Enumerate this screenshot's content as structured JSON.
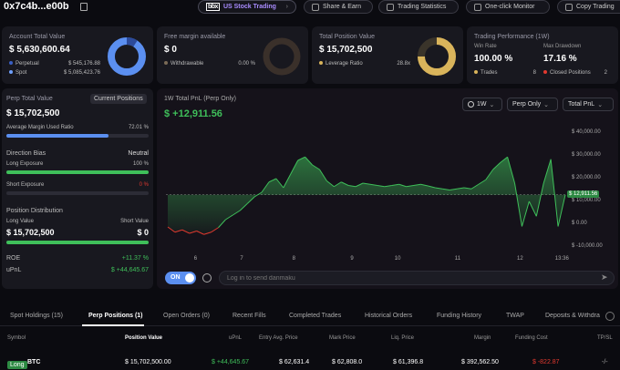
{
  "header": {
    "address": "0x7c4b...e00b",
    "us_stock_logo": "bbx",
    "us_stock": "US Stock Trading",
    "share": "Share & Earn",
    "stats": "Trading Statistics",
    "monitor": "One-click Monitor",
    "copy": "Copy Trading"
  },
  "account": {
    "label": "Account Total Value",
    "value": "$ 5,630,600.64",
    "perpetual_label": "Perpetual",
    "perpetual_value": "$ 545,176.88",
    "spot_label": "Spot",
    "spot_value": "$ 5,085,423.76"
  },
  "margin": {
    "label": "Free margin available",
    "value": "$ 0",
    "withdrawable_label": "Withdrawable",
    "withdrawable_value": "0.00 %"
  },
  "position": {
    "label": "Total Position Value",
    "value": "$ 15,702,500",
    "leverage_label": "Leverage Ratio",
    "leverage_value": "28.8x"
  },
  "performance": {
    "label": "Trading Performance (1W)",
    "win_rate_label": "Win Rate",
    "win_rate": "100.00 %",
    "drawdown_label": "Max Drawdown",
    "drawdown": "17.16 %",
    "trades_label": "Trades",
    "trades": "8",
    "closed_label": "Closed Positions",
    "closed": "2"
  },
  "perp": {
    "label": "Perp Total Value",
    "button": "Current Positions",
    "value": "$ 15,702,500",
    "avg_margin_label": "Average Margin Used Ratio",
    "avg_margin_value": "72.01 %",
    "avg_margin_fraction": 0.7201,
    "direction_label": "Direction Bias",
    "direction_value": "Neutral",
    "long_exp_label": "Long Exposure",
    "long_exp_value": "100 %",
    "short_exp_label": "Short Exposure",
    "short_exp_value": "0 %",
    "dist_label": "Position Distribution",
    "long_value_label": "Long Value",
    "short_value_label": "Short Value",
    "long_value": "$ 15,702,500",
    "short_value": "$ 0",
    "roe_label": "ROE",
    "roe_value": "+11.37 %",
    "upnl_label": "uPnL",
    "upnl_value": "$ +44,645.67"
  },
  "chart_panel": {
    "title": "1W Total PnL (Perp Only)",
    "value": "$ +12,911.56",
    "range": "1W",
    "filter": "Perp Only",
    "metric": "Total PnL",
    "toggle": "ON",
    "danmaku_placeholder": "Log in to send danmaku",
    "current_label": "$ 12,911.56"
  },
  "chart_data": {
    "type": "area",
    "title": "1W Total PnL (Perp Only)",
    "x_ticks": [
      "6",
      "7",
      "8",
      "9",
      "10",
      "11",
      "12",
      "13:36"
    ],
    "y_ticks": [
      "$ 40,000.00",
      "$ 30,000.00",
      "$ 20,000.00",
      "$ 10,000.00",
      "$ 0.00",
      "$ -10,000.00"
    ],
    "ylim": [
      -12000,
      44000
    ],
    "baseline": 12911.56,
    "values": [
      -1200,
      -3500,
      -2500,
      -4000,
      -3000,
      -4500,
      -3500,
      -1500,
      2000,
      4000,
      6000,
      9000,
      12000,
      14000,
      18500,
      20000,
      16000,
      22000,
      28000,
      29500,
      26000,
      24000,
      19000,
      16500,
      18500,
      17000,
      16500,
      18000,
      17500,
      17000,
      16500,
      17000,
      17500,
      16500,
      17000,
      17500,
      16800,
      16000,
      15500,
      15000,
      15500,
      16000,
      15500,
      17500,
      19500,
      24000,
      27000,
      29500,
      18000,
      -1000,
      10000,
      3500,
      18000,
      28500,
      -1000,
      12911.56
    ],
    "colors": {
      "above": "#3fbf5a",
      "below": "#e2392f"
    }
  },
  "tabs": [
    {
      "label": "Spot Holdings (15)"
    },
    {
      "label": "Perp Positions (1)"
    },
    {
      "label": "Open Orders (0)"
    },
    {
      "label": "Recent Fills"
    },
    {
      "label": "Completed Trades"
    },
    {
      "label": "Historical Orders"
    },
    {
      "label": "Funding History"
    },
    {
      "label": "TWAP"
    },
    {
      "label": "Deposits & Withdra"
    }
  ],
  "table": {
    "headers": [
      "Symbol",
      "Position Value",
      "uPnL",
      "Entry Avg. Price",
      "Mark Price",
      "Liq. Price",
      "Margin",
      "Funding Cost",
      "TP/SL"
    ],
    "row": {
      "side": "Long",
      "symbol": "BTC",
      "position_value": "$ 15,702,500.00",
      "upnl": "$ +44,645.67",
      "entry": "$ 62,631.4",
      "mark": "$ 62,808.0",
      "liq": "$ 61,396.8",
      "margin": "$ 392,562.50",
      "funding": "$ -822.87",
      "tpsl": "-/-"
    }
  },
  "colors": {
    "green": "#3fbf5a",
    "red": "#e2392f",
    "blue": "#5b8ff0",
    "gold": "#d9b45b",
    "purple": "#a98cff"
  }
}
